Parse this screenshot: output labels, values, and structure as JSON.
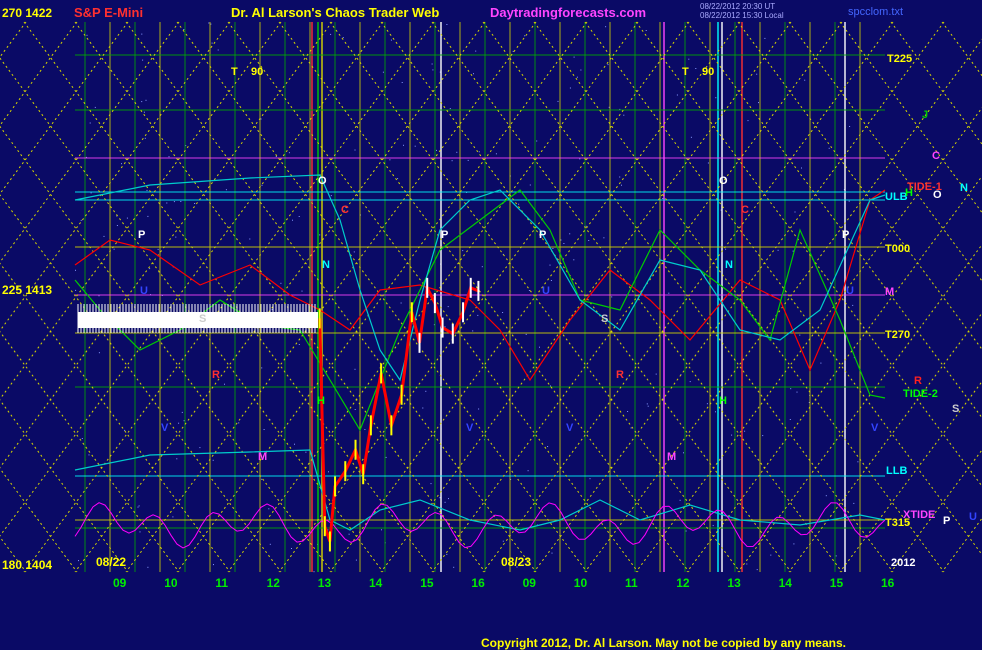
{
  "header": {
    "symbol": "S&P E-Mini",
    "title": "Dr. Al Larson's Chaos Trader Web",
    "site": "Daytradingforecasts.com",
    "stamp1": "08/22/2012 20:30 UT",
    "stamp2": "08/22/2012 15:30 Local",
    "file": "spcclom.txt"
  },
  "left_axis": [
    {
      "label": "270 1422",
      "value": 1422
    },
    {
      "label": "225 1413",
      "value": 1413
    },
    {
      "label": "180 1404",
      "value": 1404
    }
  ],
  "right_labels": [
    {
      "text": "T225",
      "color": "#ffff00"
    },
    {
      "text": "ULB",
      "color": "#00ffff"
    },
    {
      "text": "TIDE-1",
      "color": "#ff3030"
    },
    {
      "text": "T000",
      "color": "#ffff00"
    },
    {
      "text": "M",
      "color": "#ff44ff"
    },
    {
      "text": "T270",
      "color": "#ffff00"
    },
    {
      "text": "TIDE-2",
      "color": "#00ff00"
    },
    {
      "text": "LLB",
      "color": "#00ffff"
    },
    {
      "text": "XTIDE",
      "color": "#ff44ff"
    },
    {
      "text": "T315",
      "color": "#ffff00"
    },
    {
      "text": "2012",
      "color": "#ffffff"
    }
  ],
  "planet_labels": [
    {
      "text": "J",
      "color": "#00cc00"
    },
    {
      "text": "C",
      "color": "#ff44ff"
    },
    {
      "text": "H",
      "color": "#00ff00"
    },
    {
      "text": "O",
      "color": "#ffffff"
    },
    {
      "text": "N",
      "color": "#00ffff"
    },
    {
      "text": "R",
      "color": "#ff2020"
    },
    {
      "text": "S",
      "color": "#cccccc"
    },
    {
      "text": "P",
      "color": "#ffffff"
    },
    {
      "text": "U",
      "color": "#3344ff"
    }
  ],
  "chart_markers": [
    "O",
    "C",
    "P",
    "N",
    "U",
    "R",
    "S",
    "M",
    "H",
    "V",
    "T",
    "90"
  ],
  "date_labels": [
    "08/22",
    "08/23"
  ],
  "hour_ticks": [
    "09",
    "10",
    "11",
    "12",
    "13",
    "14",
    "15",
    "16",
    "09",
    "10",
    "11",
    "12",
    "13",
    "14",
    "15",
    "16"
  ],
  "footer": "Copyright 2012, Dr. Al Larson. May not be copied by any means.",
  "colors": {
    "background": "#0a0a66",
    "grid_yellow": "#d8d800",
    "grid_green": "#00aa00",
    "price_bar": "#ffffff",
    "wave_red": "#ff0000",
    "wave_green": "#00cc00",
    "wave_cyan": "#00cccc",
    "wave_magenta": "#ff00ff"
  },
  "chart_data": {
    "type": "line",
    "title": "S&P E-Mini",
    "ylim": [
      1404,
      1422
    ],
    "x_ticks": [
      "09",
      "10",
      "11",
      "12",
      "13",
      "14",
      "15",
      "16",
      "09",
      "10",
      "11",
      "12",
      "13",
      "14",
      "15",
      "16"
    ],
    "y_ticks": [
      1404,
      1413,
      1422
    ],
    "series": [
      {
        "name": "price",
        "points": [
          [
            12.9,
            1412.3
          ],
          [
            13.0,
            1405.5
          ],
          [
            13.1,
            1405.0
          ],
          [
            13.2,
            1406.8
          ],
          [
            13.4,
            1407.3
          ],
          [
            13.6,
            1408.0
          ],
          [
            13.75,
            1407.2
          ],
          [
            13.9,
            1408.8
          ],
          [
            14.1,
            1410.5
          ],
          [
            14.3,
            1408.8
          ],
          [
            14.5,
            1409.8
          ],
          [
            14.7,
            1412.5
          ],
          [
            14.85,
            1411.5
          ],
          [
            15.0,
            1413.3
          ],
          [
            15.15,
            1412.8
          ],
          [
            15.3,
            1412.0
          ],
          [
            15.5,
            1411.8
          ],
          [
            15.7,
            1412.5
          ],
          [
            15.85,
            1413.3
          ],
          [
            16.0,
            1413.2
          ]
        ]
      }
    ]
  }
}
